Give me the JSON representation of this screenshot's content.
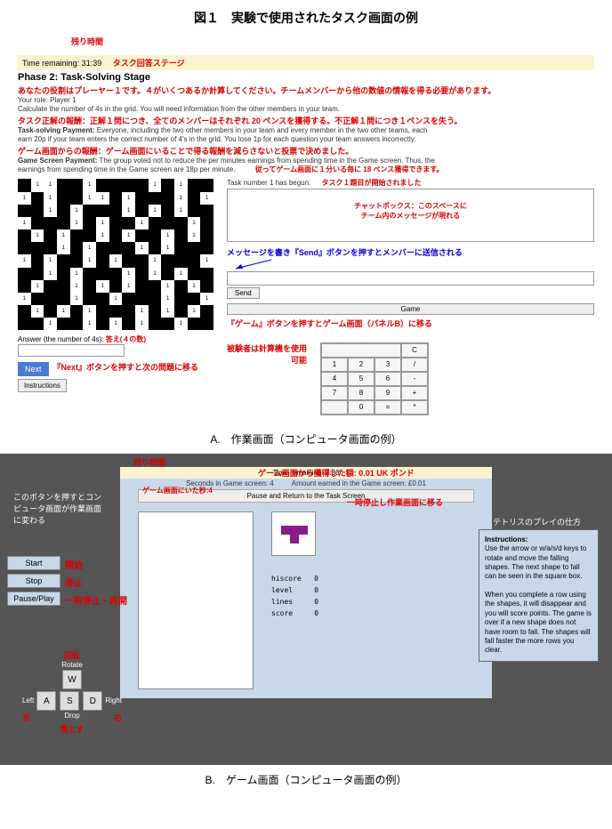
{
  "figure_title": "図１　実験で使用されたタスク画面の例",
  "panel_a": {
    "caption": "A.　作業画面（コンピュータ画面の例）",
    "time_bar": "Time remaining: 31:39",
    "phase": "Phase 2: Task-Solving Stage",
    "role": "Your role: Player 1",
    "calc_text": "Calculate the number of 4s in the grid. You will need information from the other members in your team.",
    "payment_label": "Task-solving Payment:",
    "payment_text": " Everyone, including the two other members in your team and every member in the two other teams, each",
    "payment_text2": "earn 20p if your team enters the correct number of 4's in the grid. You lose 1p for each question your team answers incorrectly.",
    "game_payment_label": "Game Screen Payment:",
    "game_payment_text": " The group voted not to reduce the per minutes earnings from spending time in the Game screen. Thus, the",
    "game_payment_text2": "earnings from spending time in the Game screen are 18p per minute.",
    "task_begun": "Task number 1 has begun:",
    "send": "Send",
    "game": "Game",
    "answer_label": "Answer (the number of 4s):",
    "next": "Next",
    "instructions": "Instructions",
    "calc_keys": [
      [
        "1",
        "2",
        "3",
        "/"
      ],
      [
        "4",
        "5",
        "6",
        "-"
      ],
      [
        "7",
        "8",
        "9",
        "+"
      ],
      [
        "",
        "0",
        "=",
        "*"
      ]
    ],
    "calc_clear": "C",
    "annotations": {
      "remaining_time": "残り時間",
      "task_stage": "タスク回答ステージ",
      "role_jp": "あなたの役割はプレーヤー１です。４がいくつあるか計算してください。チームメンバーから他の数値の情報を得る必要があります。",
      "correct_pay": "タスク正解の報酬：正解１問につき、全てのメンバーはそれぞれ 20 ペンスを獲得する。不正解１問につき１ペンスを失う。",
      "game_pay": "ゲーム画面からの報酬：ゲーム画面にいることで得る報酬を減らさないと投票で決めました。",
      "game_pay2": "従ってゲーム画面に１分いる毎に 18 ペンス獲得できます。",
      "task1_begun": "タスク１題目が開始されました",
      "chatbox": "チャットボックス：このスペースに",
      "chatbox2": "チーム内のメッセージが現れる",
      "send_msg": "メッセージを書き『Send』ボタンを押すとメンバーに送信される",
      "game_btn": "『ゲーム』ボタンを押すとゲーム画面（パネルB）に移る",
      "answer_jp": "答え(４の数)",
      "next_jp": "『Next』ボタンを押すと次の問題に移る",
      "calc_jp": "被験者は計算機を使用可能"
    }
  },
  "panel_b": {
    "caption": "B.　ゲーム画面（コンピュータ画面の例）",
    "time_bar": "Time remaining: 1:36",
    "seconds": "Seconds in Game screen: 4",
    "earned": "Amount earned in the Game screen: £0.01",
    "pause_return": "Pause and Return to the Task Screen",
    "start": "Start",
    "stop": "Stop",
    "pauseplay": "Pause/Play",
    "rotate": "Rotate",
    "left": "Left",
    "right": "Right",
    "drop": "Drop",
    "keys": {
      "w": "W",
      "a": "A",
      "s": "S",
      "d": "D"
    },
    "stats": {
      "hiscore": "hiscore",
      "level": "level",
      "lines": "lines",
      "score": "score",
      "val": "0"
    },
    "instructions_title": "Instructions:",
    "instructions_text": "Use the arrow or w/a/s/d keys to rotate and move the falling shapes. The next shape to fall can be seen in the square box.",
    "instructions_text2": "When you complete a row using the shapes, it will disappear and you will score points. The game is over if a new shape does not have room to fall. The shapes will fall faster the more rows you clear.",
    "annotations": {
      "remaining_time": "残り時間",
      "earned_jp": "ゲーム画面から獲得した額: 0.01 UK ポンド",
      "seconds_jp": "ゲーム画面にいた秒:4",
      "pause_jp": "一時停止し作業画面に移る",
      "this_btn": "このボタンを押すとコンピュータ画面が作業画面に変わる",
      "tetris_how": "テトリスのプレイの仕方",
      "start_jp": "開始",
      "stop_jp": "停止",
      "pauseplay_jp": "一時停止・再開",
      "rotate_jp": "回転",
      "left_jp": "左",
      "right_jp": "右",
      "drop_jp": "落とす"
    }
  }
}
